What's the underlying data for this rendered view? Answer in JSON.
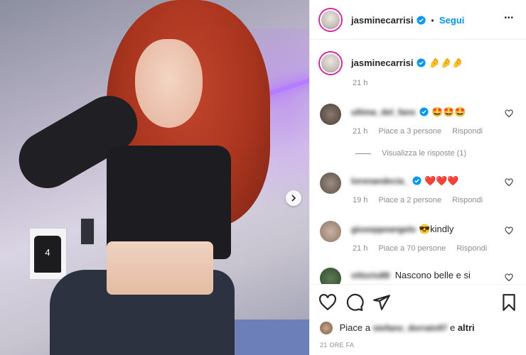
{
  "post": {
    "author": "jasminecarrisi",
    "follow_label": "Segui",
    "separator": "•",
    "more_label": "•••",
    "caption_emoji": "🤌🤌🤌",
    "caption_time": "21 h",
    "jersey_text": "4"
  },
  "comments": [
    {
      "user": "ultima_del_fans",
      "text": "🤩🤩🤩",
      "time": "21 h",
      "likes": "Piace a 3 persone",
      "reply": "Rispondi",
      "view_replies": "Visualizza le risposte (1)"
    },
    {
      "user": "lorenandecia_",
      "text": "❤️❤️❤️",
      "time": "19 h",
      "likes": "Piace a 2 persone",
      "reply": "Rispondi"
    },
    {
      "user": "giuseppeangelo",
      "text": "😎kindly",
      "time": "21 h",
      "likes": "Piace a 70 persone",
      "reply": "Rispondi"
    },
    {
      "user": "vittorio88",
      "text": "Nascono belle e si"
    }
  ],
  "footer": {
    "likes_prefix": "Piace a",
    "likes_user": "stefano_dorrato97",
    "likes_and": "e",
    "likes_others": "altri",
    "timestamp": "21 ORE FA"
  },
  "icons": {
    "heart": "heart-icon",
    "comment": "comment-icon",
    "share": "share-icon",
    "save": "bookmark-icon",
    "verified": "verified-icon",
    "next": "chevron-right-icon"
  },
  "colors": {
    "verified": "#0095f6",
    "follow": "#0095f6",
    "muted": "#8e8e8e"
  }
}
